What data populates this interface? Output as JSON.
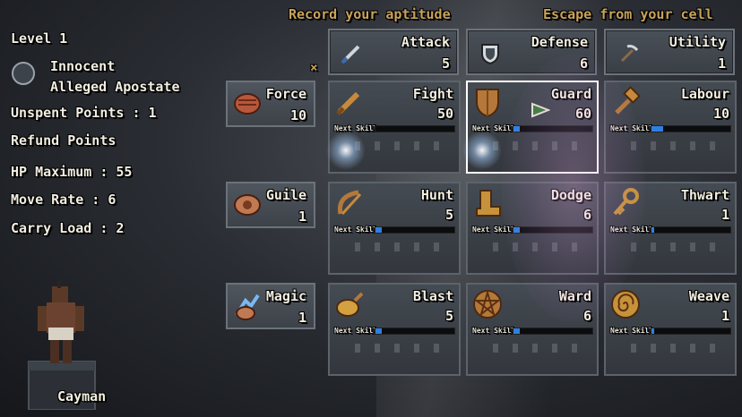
{
  "headers": {
    "left": "Record your aptitude",
    "right": "Escape from your cell"
  },
  "sidebar": {
    "level": "Level 1",
    "crime_line1": "Innocent",
    "crime_line2": "Alleged Apostate",
    "unspent": "Unspent Points : 1",
    "refund": "Refund Points",
    "hp": "HP Maximum : 55",
    "move": "Move Rate : 6",
    "carry": "Carry Load : 2",
    "character_name": "Cayman"
  },
  "close_mark": "×",
  "top_row": [
    {
      "label": "Attack",
      "value": "5",
      "icon": "sword-icon"
    },
    {
      "label": "Defense",
      "value": "6",
      "icon": "shield-icon"
    },
    {
      "label": "Utility",
      "value": "1",
      "icon": "pickaxe-icon"
    }
  ],
  "rows": [
    {
      "attr": {
        "label": "Force",
        "value": "10",
        "icon": "fist-icon"
      },
      "cells": [
        {
          "label": "Fight",
          "value": "50",
          "next": "Next Skill",
          "progress": 0,
          "icon": "sword-icon"
        },
        {
          "label": "Guard",
          "value": "60",
          "next": "Next Skill",
          "progress": 0.08,
          "icon": "wooden-shield-icon",
          "selected": true
        },
        {
          "label": "Labour",
          "value": "10",
          "next": "Next Skill",
          "progress": 0.15,
          "icon": "hammer-icon"
        }
      ]
    },
    {
      "attr": {
        "label": "Guile",
        "value": "1",
        "icon": "hand-icon"
      },
      "cells": [
        {
          "label": "Hunt",
          "value": "5",
          "next": "Next Skill",
          "progress": 0.08,
          "icon": "bow-icon"
        },
        {
          "label": "Dodge",
          "value": "6",
          "next": "Next Skill",
          "progress": 0.08,
          "icon": "boot-icon"
        },
        {
          "label": "Thwart",
          "value": "1",
          "next": "Next Skill",
          "progress": 0.03,
          "icon": "key-icon"
        }
      ]
    },
    {
      "attr": {
        "label": "Magic",
        "value": "1",
        "icon": "magic-hand-icon"
      },
      "cells": [
        {
          "label": "Blast",
          "value": "5",
          "next": "Next Skill",
          "progress": 0.08,
          "icon": "bomb-icon"
        },
        {
          "label": "Ward",
          "value": "6",
          "next": "Next Skill",
          "progress": 0.08,
          "icon": "pentagram-icon"
        },
        {
          "label": "Weave",
          "value": "1",
          "next": "Next Skill",
          "progress": 0.03,
          "icon": "spiral-icon"
        }
      ]
    }
  ],
  "colors": {
    "accent_gold": "#c9a35a",
    "progress_blue": "#2f7fe0",
    "text": "#f2eee0"
  }
}
